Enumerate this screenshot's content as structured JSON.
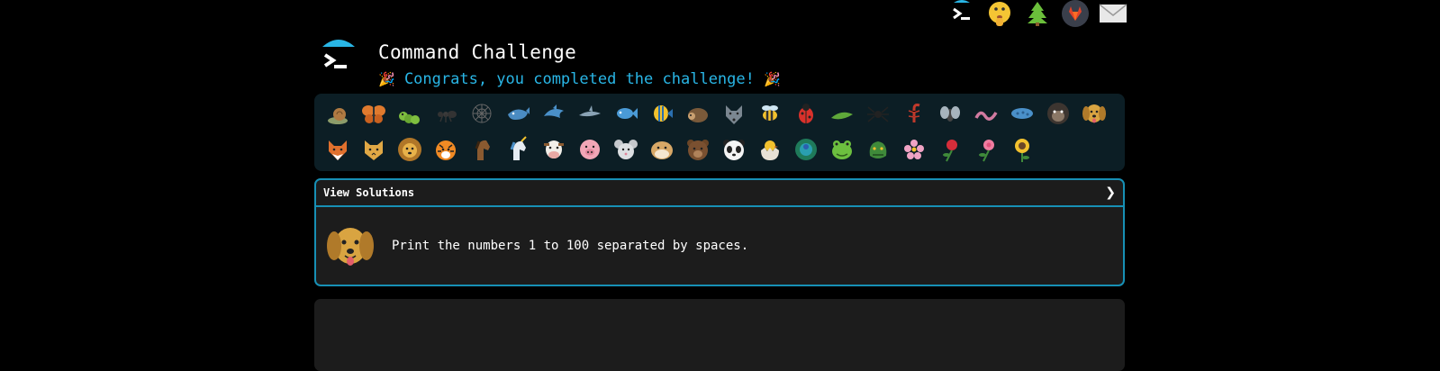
{
  "header": {
    "title": "Command Challenge",
    "congrats": "Congrats, you completed the challenge!",
    "party_left": "🎉",
    "party_right": "🎉"
  },
  "topbar": {
    "icons": [
      "terminal-icon",
      "shush-face-icon",
      "tree-icon",
      "gitlab-icon",
      "mail-icon"
    ]
  },
  "strip": {
    "row1": [
      "snail",
      "butterfly",
      "caterpillar",
      "ant",
      "spider-web",
      "whale",
      "dolphin",
      "shark",
      "fish",
      "tropical-fish",
      "hedgehog",
      "wolf",
      "bee",
      "ladybug",
      "leaf-insect",
      "spider",
      "scorpion",
      "fly",
      "worm",
      "microbe",
      "gorilla",
      "dog"
    ],
    "row2": [
      "fox",
      "cat",
      "lion",
      "tiger",
      "horse",
      "unicorn",
      "cow",
      "pig",
      "mouse",
      "hamster",
      "bear",
      "panda",
      "hatching-chick",
      "peacock",
      "frog",
      "dragon",
      "blossom",
      "rose",
      "flower",
      "sunflower"
    ],
    "active": "dog"
  },
  "panel": {
    "title": "View Solutions",
    "chevron": "❯",
    "task": "Print the numbers 1 to 100 separated by spaces."
  },
  "colors": {
    "accent": "#29b6e6",
    "border": "#1790b5",
    "strip_bg": "#0c1e25",
    "panel_bg": "#1c1c1c"
  }
}
